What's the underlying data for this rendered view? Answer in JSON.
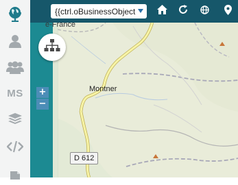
{
  "sidebar": {
    "items": [
      {
        "icon": "globe-icon"
      },
      {
        "icon": "user-icon"
      },
      {
        "icon": "users-icon"
      },
      {
        "label": "MS"
      },
      {
        "icon": "layers-icon"
      },
      {
        "icon": "code-icon"
      },
      {
        "icon": "document-icon"
      }
    ]
  },
  "topbar": {
    "select_value": "{{ctrl.oBusinessObject",
    "icons": [
      "home-icon",
      "refresh-icon",
      "globe-icon",
      "location-pin-icon"
    ]
  },
  "map": {
    "labels": {
      "region": "e-France",
      "town": "Montner",
      "road": "D 612"
    },
    "zoom_in": "+",
    "zoom_out": "−"
  },
  "colors": {
    "header_bg": "#16576a",
    "sidebar_bg": "#f3f4f4",
    "accent": "#1c8a92",
    "zoom_bg": "#4c8db7"
  }
}
